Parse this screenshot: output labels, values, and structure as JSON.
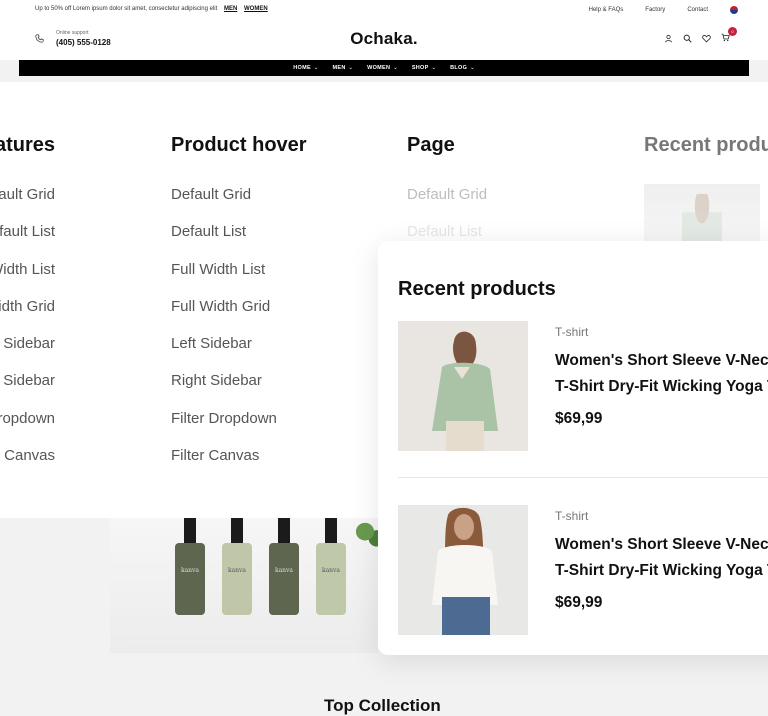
{
  "topbar": {
    "promo": "Up to 50% off Lorem ipsum dolor sit amet, consectetur adipiscing elit",
    "promo_link_men": "MEN",
    "promo_link_women": "WOMEN",
    "help": "Help & FAQs",
    "factory": "Factory",
    "contact": "Contact"
  },
  "header": {
    "support_label": "Online support",
    "phone": "(405) 555-0128",
    "logo": "Ochaka.",
    "cart_count": "0"
  },
  "nav": {
    "items": [
      {
        "label": "HOME"
      },
      {
        "label": "MEN"
      },
      {
        "label": "WOMEN"
      },
      {
        "label": "SHOP"
      },
      {
        "label": "BLOG"
      }
    ]
  },
  "mega": {
    "col1": {
      "title": "Features",
      "items": [
        "Default Grid",
        "Default List",
        "Full Width List",
        "Full Width Grid",
        "Left Sidebar",
        "Right Sidebar",
        "Filter Dropdown",
        "Filter Canvas"
      ]
    },
    "col2": {
      "title": "Product hover",
      "items": [
        "Default Grid",
        "Default List",
        "Full Width List",
        "Full Width Grid",
        "Left Sidebar",
        "Right Sidebar",
        "Filter Dropdown",
        "Filter Canvas"
      ]
    },
    "col3": {
      "title": "Page",
      "items": [
        "Default Grid",
        "Default List"
      ]
    },
    "col4": {
      "title": "Recent products"
    }
  },
  "banner": {
    "bottle_label": "kanva"
  },
  "recent_card": {
    "title": "Recent products",
    "products": [
      {
        "category": "T-shirt",
        "name_line1": "Women's Short Sleeve V-Neck",
        "name_line2": "T-Shirt Dry-Fit Wicking Yoga Top",
        "price": "$69,99"
      },
      {
        "category": "T-shirt",
        "name_line1": "Women's Short Sleeve V-Neck",
        "name_line2": "T-Shirt Dry-Fit Wicking Yoga Top",
        "price": "$69,99"
      }
    ]
  },
  "section": {
    "title": "Top Collection"
  },
  "colors": {
    "accent": "#c81f3a",
    "nav_bg": "#000000"
  }
}
